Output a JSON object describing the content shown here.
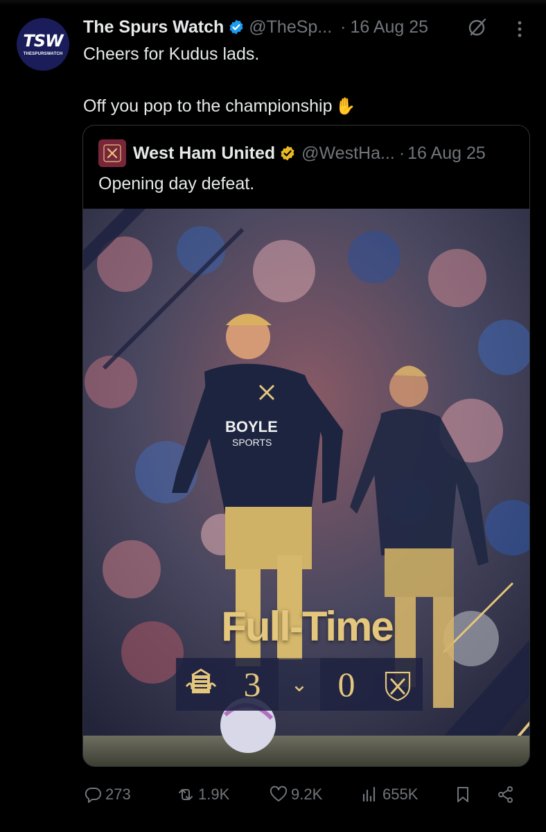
{
  "tweet": {
    "author": {
      "display_name": "The Spurs Watch",
      "handle": "@TheSp...",
      "verified": true,
      "avatar_text": "TSW",
      "avatar_subtext": "THESPURSWATCH"
    },
    "separator": "·",
    "date": "16 Aug 25",
    "text_line1": "Cheers for Kudus lads.",
    "text_line2": "Off you pop to the championship",
    "emoji": "waving-hand",
    "icons": [
      "grok-icon",
      "more-icon"
    ]
  },
  "quoted": {
    "author": {
      "display_name": "West Ham United",
      "handle": "@WestHa...",
      "verified_color": "#e8b923"
    },
    "separator": "·",
    "date": "16 Aug 25",
    "text": "Opening day defeat.",
    "media": {
      "graphic_title": "Full-Time",
      "home_score": "3",
      "away_score": "0",
      "home_crest": "sunderland-crest",
      "away_crest": "west-ham-crest",
      "shirt_sponsor": "BOYLE SPORTS"
    }
  },
  "actions": {
    "replies": "273",
    "reposts": "1.9K",
    "likes": "9.2K",
    "views": "655K"
  },
  "colors": {
    "background": "#000000",
    "text": "#e7e9ea",
    "muted": "#71767b",
    "verified_blue": "#1d9bf0",
    "gold": "#e4c67d"
  }
}
